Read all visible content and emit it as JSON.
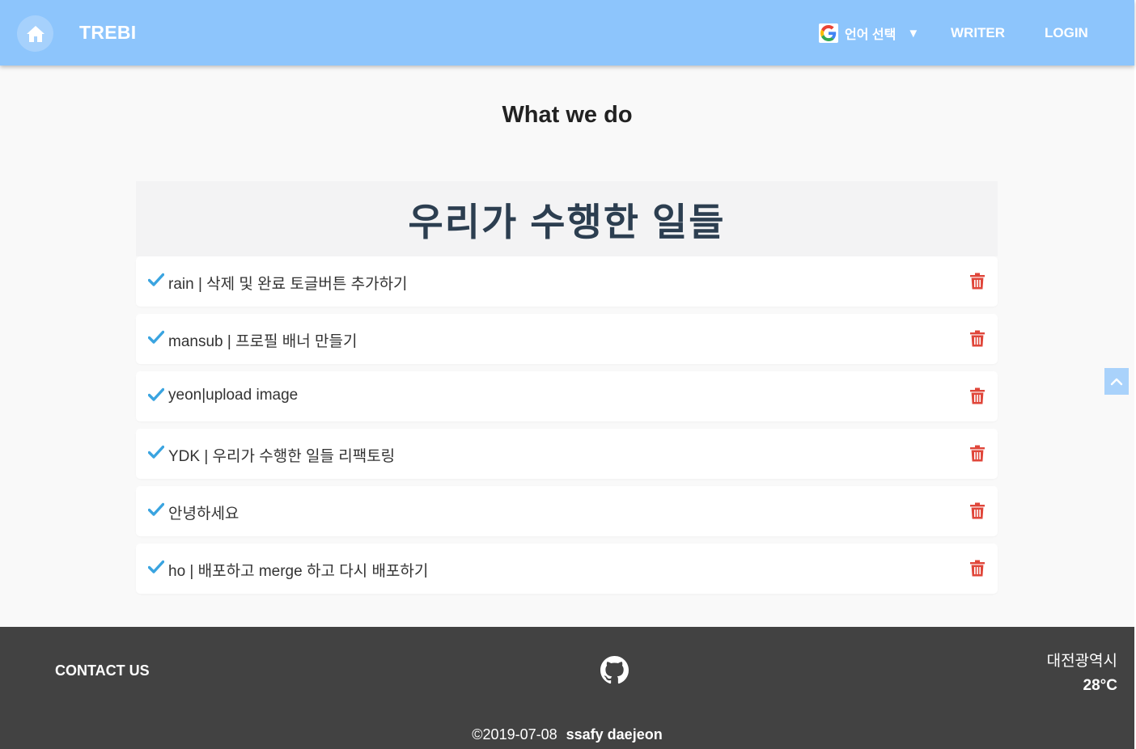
{
  "header": {
    "brand": "TREBI",
    "language_label": "언어 선택",
    "language_caret": "▼",
    "nav": {
      "writer": "WRITER",
      "login": "LOGIN"
    },
    "bg_color": "#8dc5fc"
  },
  "main": {
    "section_title": "What we do",
    "board_title": "우리가 수행한 일들",
    "todos": [
      {
        "text": "rain | 삭제 및 완료 토글버튼 추가하기",
        "done": true
      },
      {
        "text": "mansub | 프로필 배너 만들기",
        "done": true
      },
      {
        "text": "yeon|upload image",
        "done": true
      },
      {
        "text": "YDK | 우리가 수행한 일들 리팩토링",
        "done": true
      },
      {
        "text": "안녕하세요",
        "done": true
      },
      {
        "text": "ho | 배포하고 merge 하고 다시 배포하기",
        "done": true
      }
    ],
    "check_color": "#3aa4e0",
    "delete_color": "#e0463a"
  },
  "footer": {
    "contact": "CONTACT US",
    "weather_city": "대전광역시",
    "weather_temp": "28°C",
    "copyright_date": "©2019-07-08",
    "copyright_org": "ssafy daejeon",
    "bg_color": "#424242"
  },
  "icons": {
    "home": "home-icon",
    "google": "google-icon",
    "check": "check-icon",
    "trash": "trash-icon",
    "scroll_top": "chevron-up-icon",
    "github": "github-icon"
  }
}
